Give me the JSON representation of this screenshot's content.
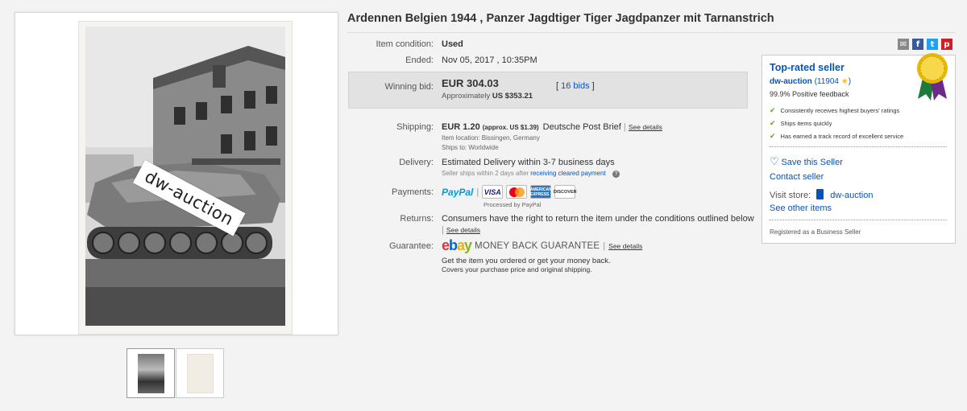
{
  "listing": {
    "title": "Ardennen Belgien 1944 , Panzer Jagdtiger Tiger Jagdpanzer mit Tarnanstrich",
    "watermark": "dw-auction"
  },
  "details": {
    "condition_label": "Item condition:",
    "condition_value": "Used",
    "ended_label": "Ended:",
    "ended_value": "Nov 05, 2017 , 10:35PM",
    "winning_label": "Winning bid:",
    "winning_value": "EUR 304.03",
    "approx_prefix": "Approximately",
    "approx_value": "US $353.21",
    "bids_open": "[",
    "bids_link": "16 bids",
    "bids_close": "]",
    "shipping_label": "Shipping:",
    "shipping_value": "EUR 1.20",
    "shipping_approx": "(approx. US $1.39)",
    "shipping_service": "Deutsche Post Brief",
    "see_details": "See details",
    "item_location": "Item location:  Bissingen, Germany",
    "ships_to": "Ships to:  Worldwide",
    "delivery_label": "Delivery:",
    "delivery_value": "Estimated Delivery within 3-7 business days",
    "delivery_note_prefix": "Seller ships within 2 days after",
    "delivery_note_link": "receiving cleared payment",
    "payments_label": "Payments:",
    "paypal_a": "Pay",
    "paypal_b": "Pal",
    "cards": [
      "VISA",
      "",
      "AMERICAN EXPRESS",
      "DISCOVER"
    ],
    "processed_by": "Processed by PayPal",
    "returns_label": "Returns:",
    "returns_value": "Consumers have the right to return the item under the conditions outlined below",
    "guarantee_label": "Guarantee:",
    "ebay_e": "e",
    "ebay_b": "b",
    "ebay_a": "a",
    "ebay_y": "y",
    "mbg_text": "MONEY BACK GUARANTEE",
    "guarantee_line1": "Get the item you ordered or get your money back.",
    "guarantee_line2": "Covers your purchase price and original shipping."
  },
  "share_icons": [
    "email-icon",
    "facebook-icon",
    "twitter-icon",
    "pinterest-icon"
  ],
  "seller": {
    "badge": "Top-rated seller",
    "name": "dw-auction",
    "score": "(11904",
    "score_close": ")",
    "feedback": "99.9% Positive feedback",
    "checks": [
      "Consistently receives highest buyers' ratings",
      "Ships items quickly",
      "Has earned a track record of excellent service"
    ],
    "save": "Save this Seller",
    "contact": "Contact seller",
    "visit_store": "Visit store:",
    "store_name": "dw-auction",
    "see_other": "See other items",
    "registered": "Registered as a Business Seller"
  },
  "colors": {
    "link": "#0654ba",
    "check": "#5ba71b",
    "bid_box": "#e2e2e2",
    "star": "#f5c518"
  }
}
